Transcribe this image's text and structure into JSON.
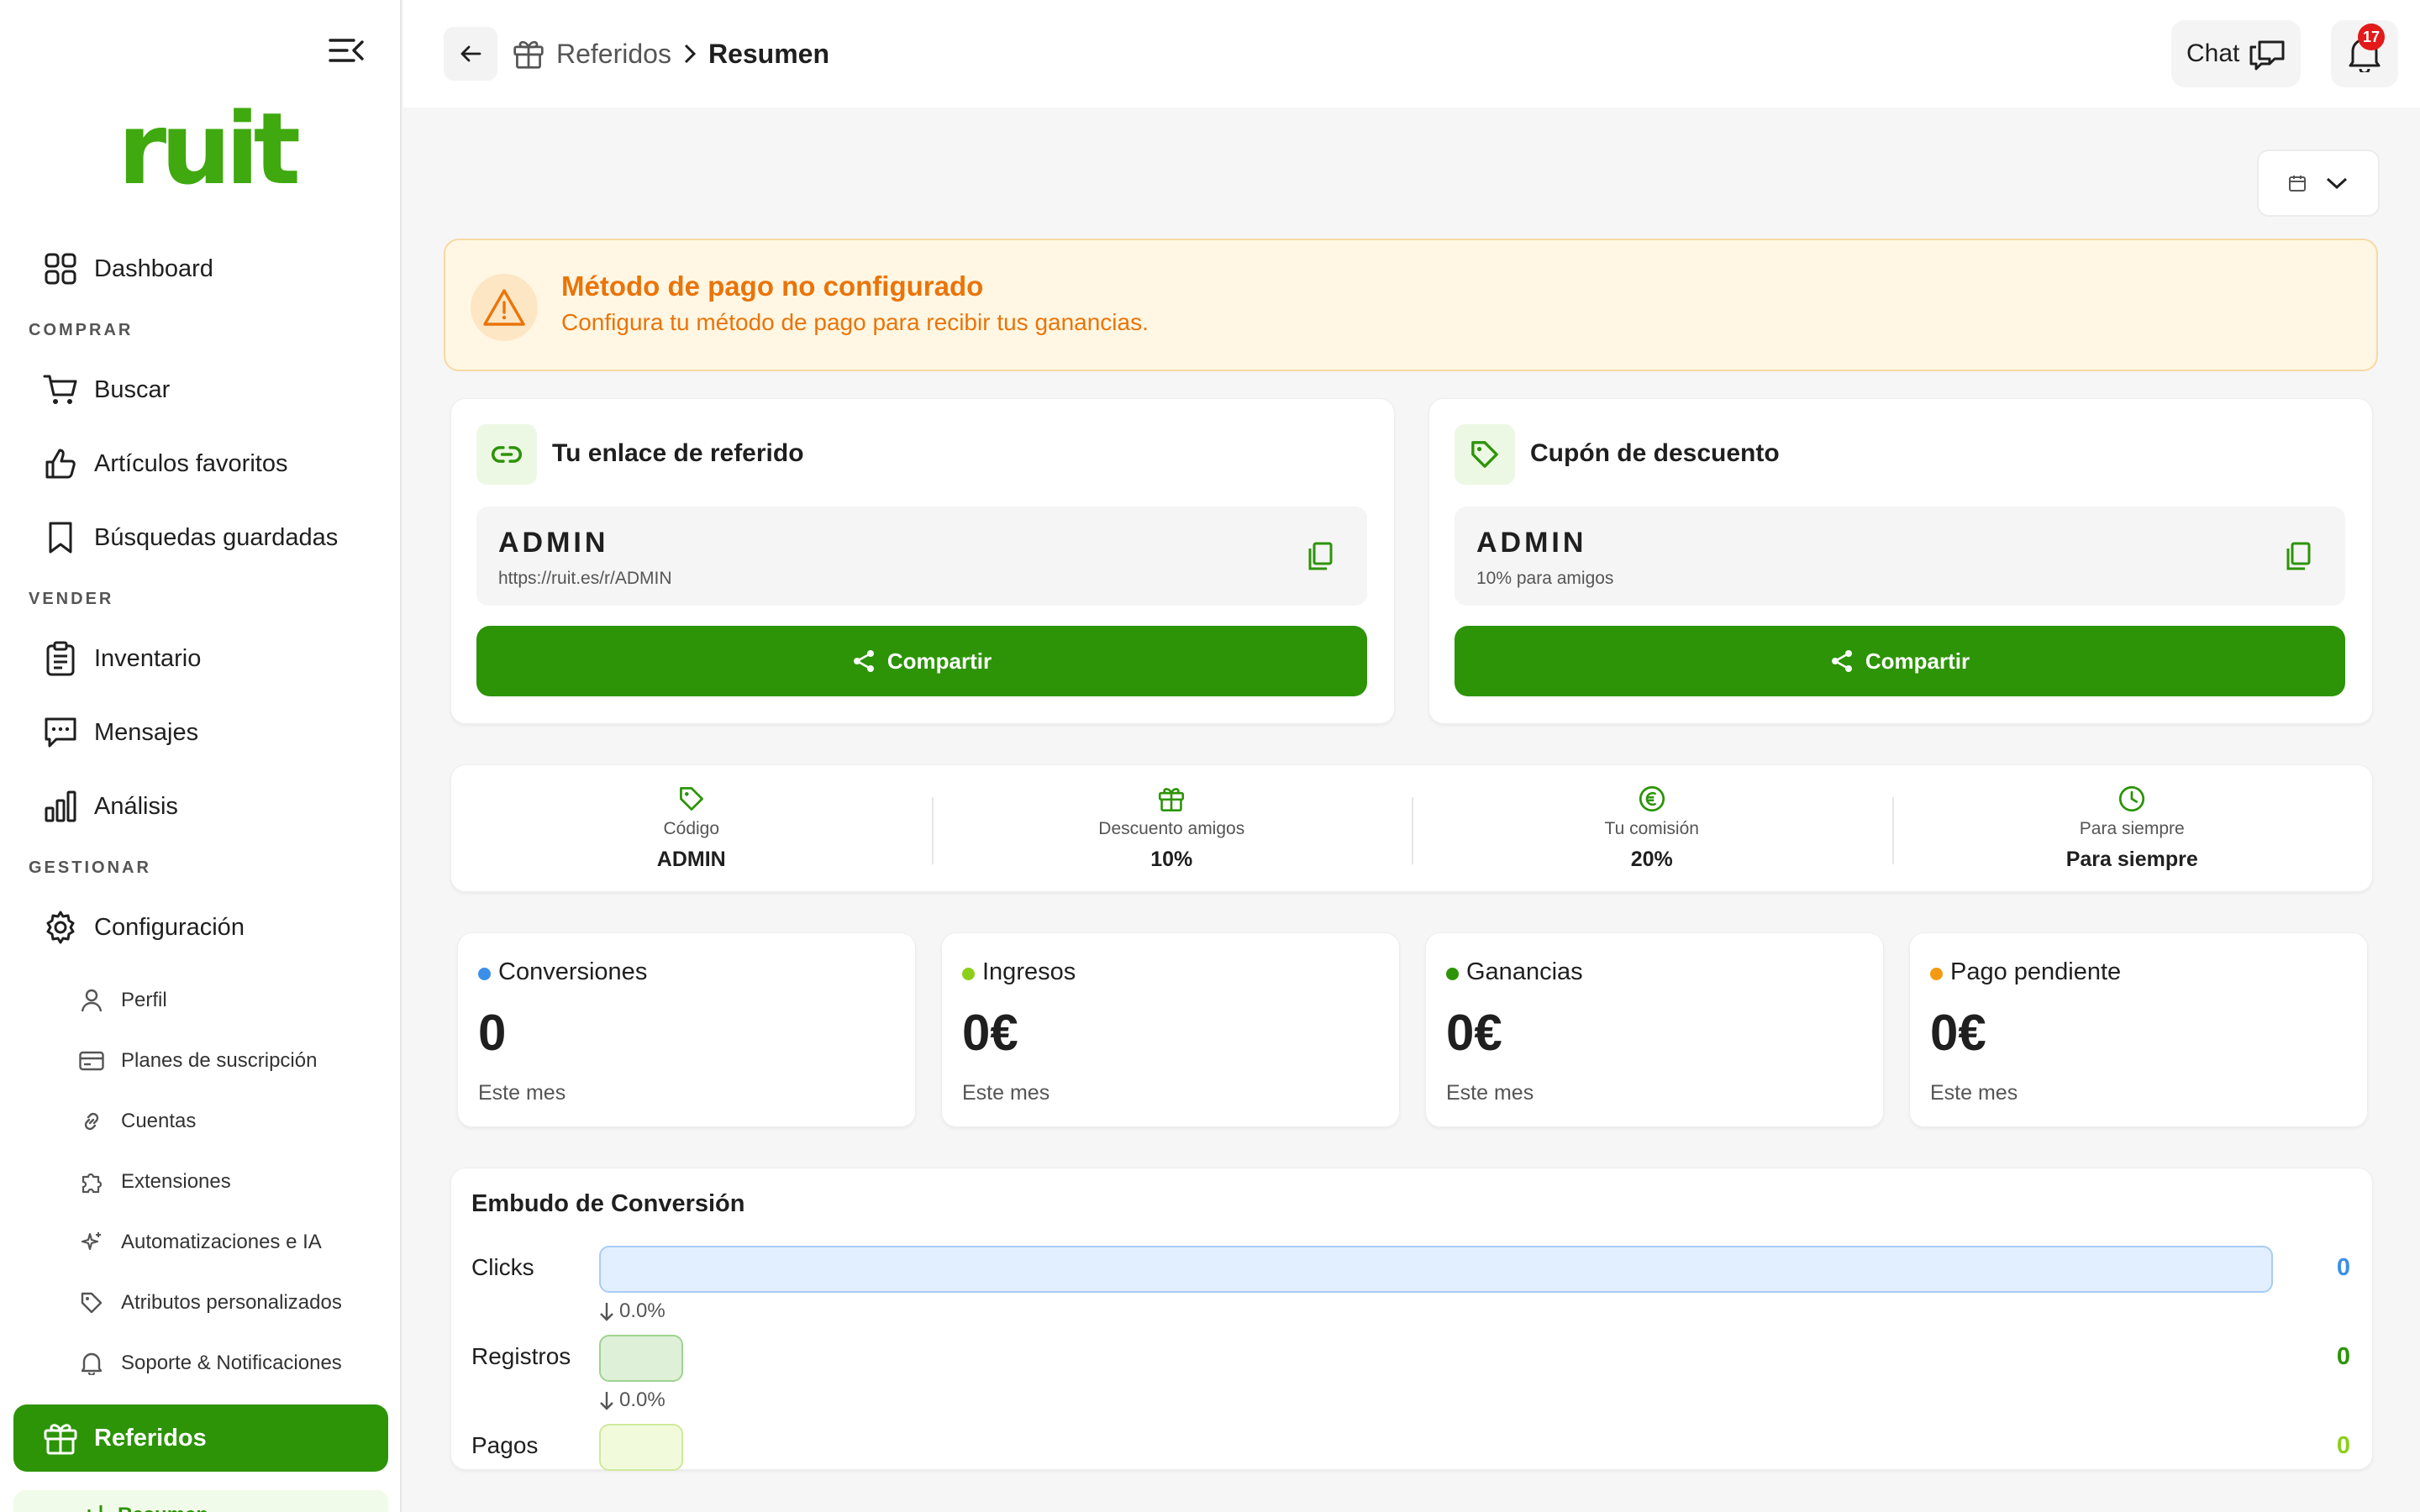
{
  "brand": {
    "logo_text": "ruit",
    "accent": "#2c9406",
    "logo_color": "#3fa90f"
  },
  "sidebar": {
    "dashboard": "Dashboard",
    "section_comprar": "COMPRAR",
    "buscar": "Buscar",
    "favoritos": "Artículos favoritos",
    "busquedas": "Búsquedas guardadas",
    "section_vender": "VENDER",
    "inventario": "Inventario",
    "mensajes": "Mensajes",
    "analisis": "Análisis",
    "section_gestionar": "GESTIONAR",
    "configuracion": "Configuración",
    "sub": {
      "perfil": "Perfil",
      "planes": "Planes de suscripción",
      "cuentas": "Cuentas",
      "extensiones": "Extensiones",
      "automatizaciones": "Automatizaciones e IA",
      "atributos": "Atributos personalizados",
      "soporte": "Soporte & Notificaciones"
    },
    "referidos": "Referidos",
    "resumen": "Resumen"
  },
  "header": {
    "crumb_parent": "Referidos",
    "crumb_current": "Resumen",
    "chat_label": "Chat",
    "notifications_count": "17"
  },
  "alert": {
    "title": "Método de pago no configurado",
    "description": "Configura tu método de pago para recibir tus ganancias.",
    "color": "#ea7409"
  },
  "referral_link": {
    "title": "Tu enlace de referido",
    "code": "ADMIN",
    "url": "https://ruit.es/r/ADMIN",
    "share_label": "Compartir"
  },
  "coupon": {
    "title": "Cupón de descuento",
    "code": "ADMIN",
    "detail": "10% para amigos",
    "share_label": "Compartir"
  },
  "stats": [
    {
      "key": "Código",
      "value": "ADMIN",
      "icon": "tag-icon"
    },
    {
      "key": "Descuento amigos",
      "value": "10%",
      "icon": "gift-icon"
    },
    {
      "key": "Tu comisión",
      "value": "20%",
      "icon": "euro-icon"
    },
    {
      "key": "Para siempre",
      "value": "Para siempre",
      "icon": "clock-icon"
    }
  ],
  "metrics": [
    {
      "name": "Conversiones",
      "value": "0",
      "period": "Este mes",
      "color": "#3b8fe8"
    },
    {
      "name": "Ingresos",
      "value": "0€",
      "period": "Este mes",
      "color": "#8ccf1a"
    },
    {
      "name": "Ganancias",
      "value": "0€",
      "period": "Este mes",
      "color": "#2c9406"
    },
    {
      "name": "Pago pendiente",
      "value": "0€",
      "period": "Este mes",
      "color": "#f39a12"
    }
  ],
  "funnel": {
    "title": "Embudo de Conversión",
    "rows": [
      {
        "label": "Clicks",
        "value": "0",
        "color": "#3b8fe8"
      },
      {
        "label": "Registros",
        "value": "0",
        "color": "#2c9406"
      },
      {
        "label": "Pagos",
        "value": "0",
        "color": "#8ccf1a"
      }
    ],
    "drop1": "0.0%",
    "drop2": "0.0%"
  }
}
